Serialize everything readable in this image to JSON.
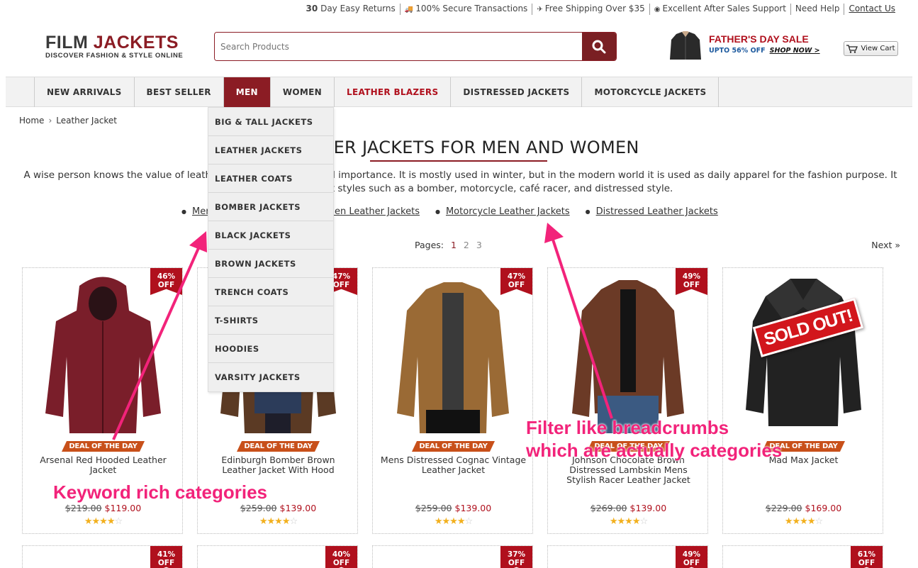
{
  "topbar": {
    "returns_bold": "30",
    "returns": "Day Easy Returns",
    "secure": "100% Secure Transactions",
    "shipping": "Free Shipping Over $35",
    "support": "Excellent After Sales Support",
    "help": "Need Help",
    "contact": "Contact Us"
  },
  "header": {
    "logo_word1": "FILM",
    "logo_word2": "JACKETS",
    "logo_tagline": "DISCOVER FASHION & STYLE ONLINE",
    "search_placeholder": "Search Products",
    "promo_title": "FATHER'S DAY SALE",
    "promo_sub": "UPTO 56% OFF",
    "promo_cta": "SHOP NOW >",
    "cart_label": "View Cart"
  },
  "nav": {
    "items": [
      {
        "label": "NEW ARRIVALS"
      },
      {
        "label": "BEST SELLER"
      },
      {
        "label": "MEN"
      },
      {
        "label": "WOMEN"
      },
      {
        "label": "LEATHER BLAZERS"
      },
      {
        "label": "DISTRESSED JACKETS"
      },
      {
        "label": "MOTORCYCLE JACKETS"
      }
    ]
  },
  "dropdown": {
    "items": [
      "BIG & TALL JACKETS",
      "LEATHER JACKETS",
      "LEATHER COATS",
      "BOMBER JACKETS",
      "BLACK JACKETS",
      "BROWN JACKETS",
      "TRENCH COATS",
      "T-SHIRTS",
      "HOODIES",
      "VARSITY JACKETS"
    ]
  },
  "breadcrumb": {
    "home": "Home",
    "sep": "›",
    "current": "Leather Jacket"
  },
  "content": {
    "title": "LEATHER JACKETS FOR MEN AND WOMEN",
    "description": "A wise person knows the value of leather jackets, their uses, and importance. It is mostly used in winter, but in the modern world it is used as daily apparel for the fashion purpose. It comes in different styles such as a bomber, motorcycle, café racer, and distressed style.",
    "category_links": [
      "Men Leather Jackets",
      "Women Leather Jackets",
      "Motorcycle Leather Jackets",
      "Distressed Leather Jackets"
    ],
    "pages_label": "Pages:",
    "pages": [
      "1",
      "2",
      "3"
    ],
    "next": "Next »"
  },
  "products": [
    {
      "badge_pct": "46%",
      "badge_off": "OFF",
      "deal": "DEAL OF THE DAY",
      "name": "Arsenal Red Hooded Leather Jacket",
      "old_price": "$219.00",
      "price": "$119.00",
      "stars": "★★★★",
      "stars_empty": "☆",
      "rating": 4,
      "color": "#7a1e2a"
    },
    {
      "badge_pct": "47%",
      "badge_off": "OFF",
      "deal": "DEAL OF THE DAY",
      "name": "Edinburgh Bomber Brown Leather Jacket With Hood",
      "old_price": "$259.00",
      "price": "$139.00",
      "stars": "★★★★",
      "stars_empty": "☆",
      "rating": 4,
      "color": "#5b3a24"
    },
    {
      "badge_pct": "47%",
      "badge_off": "OFF",
      "deal": "DEAL OF THE DAY",
      "name": "Mens Distressed Cognac Vintage Leather Jacket",
      "old_price": "$259.00",
      "price": "$139.00",
      "stars": "★★★★",
      "stars_empty": "☆",
      "rating": 4,
      "color": "#9a6a35"
    },
    {
      "badge_pct": "49%",
      "badge_off": "OFF",
      "deal": "DEAL OF THE DAY",
      "name": "Johnson Chocolate Brown Distressed Lambskin Mens Stylish Racer Leather Jacket",
      "old_price": "$269.00",
      "price": "$139.00",
      "stars": "★★★★",
      "stars_empty": "☆",
      "rating": 4,
      "color": "#6b3a26"
    },
    {
      "badge_pct": "",
      "badge_off": "",
      "deal": "DEAL OF THE DAY",
      "name": "Mad Max Jacket",
      "old_price": "$229.00",
      "price": "$169.00",
      "stars": "★★★★",
      "stars_empty": "☆",
      "rating": 4,
      "color": "#222222",
      "sold_out": "SOLD OUT!"
    }
  ],
  "row2_badges": [
    {
      "pct": "41%",
      "off": "OFF"
    },
    {
      "pct": "40%",
      "off": "OFF"
    },
    {
      "pct": "37%",
      "off": "OFF"
    },
    {
      "pct": "49%",
      "off": "OFF"
    },
    {
      "pct": "61%",
      "off": "OFF"
    }
  ],
  "annotations": {
    "filter_note_line1": "Filter like breadcrumbs",
    "filter_note_line2": "which are actually categories",
    "keyword_note": "Keyword rich categories",
    "color": "#f2237a"
  },
  "colors": {
    "brand": "#8b1c24",
    "sale_red": "#b0101d",
    "deal_orange": "#c8501a",
    "promo_blue": "#1d5a9e"
  }
}
